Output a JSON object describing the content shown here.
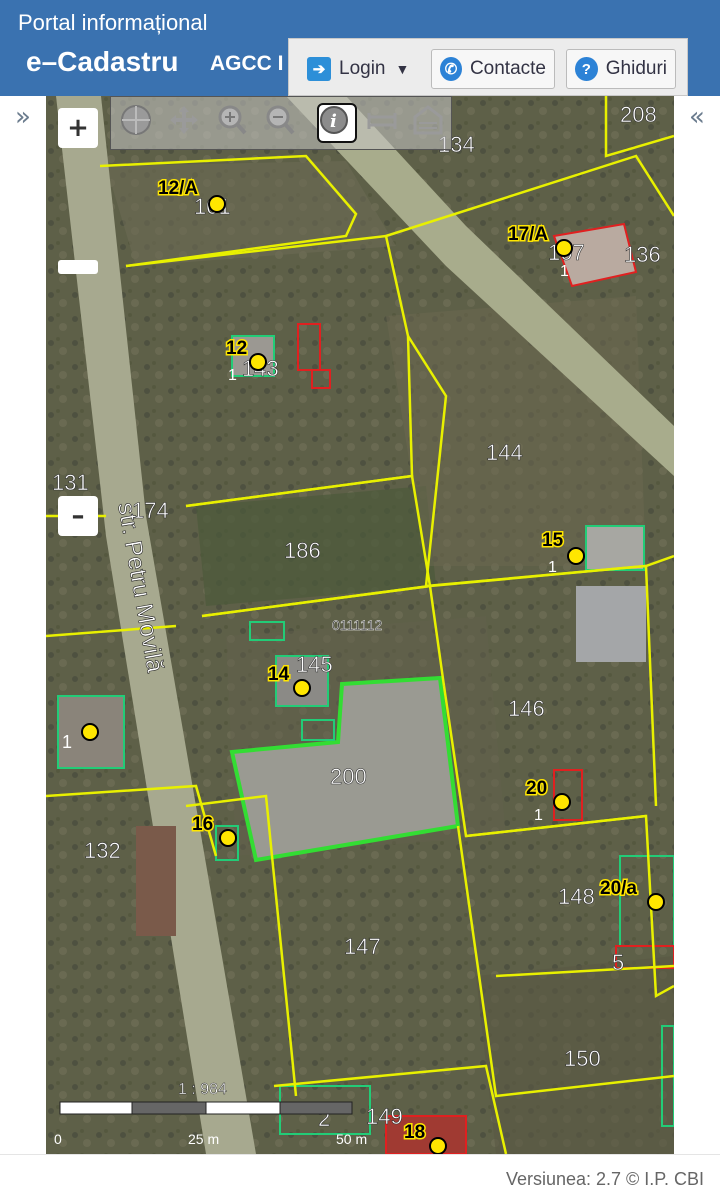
{
  "header": {
    "portal_title": "Portal informațional",
    "app_title": "e–Cadastru",
    "agency": "AGCC I",
    "login_label": "Login",
    "contacts_label": "Contacte",
    "guides_label": "Ghiduri"
  },
  "sidebar": {
    "collapse_left": "»",
    "collapse_right": "«"
  },
  "map": {
    "zoom_in": "+",
    "zoom_out": "–",
    "street_label": "str. Petru Movilă",
    "sector_code": "0111112",
    "scale_ratio": "1 : 984",
    "scale_ticks": [
      "0",
      "25 m",
      "50 m"
    ],
    "parcels": [
      "208",
      "134",
      "101",
      "107",
      "136",
      "143",
      "144",
      "131",
      "174",
      "186",
      "145",
      "146",
      "200",
      "132",
      "147",
      "148",
      "150",
      "149",
      "2",
      "5"
    ],
    "address_markers": [
      "12/A",
      "17/A",
      "12",
      "15",
      "14",
      "20",
      "16",
      "20/a",
      "18"
    ],
    "marker_suffix": "1",
    "tools": [
      "globe-icon",
      "pan-icon",
      "zoom-in-icon",
      "zoom-out-icon",
      "info-icon",
      "measure-icon",
      "building-icon"
    ],
    "active_tool": "info-icon"
  },
  "footer": {
    "version": "Versiunea: 2.7 © I.P. CBI"
  },
  "colors": {
    "header": "#3a72b0",
    "parcel_line": "#e8f000",
    "selected": "#33dd33",
    "building": "#22cc77",
    "building_alt": "#e02020",
    "marker": "#ffe600"
  }
}
